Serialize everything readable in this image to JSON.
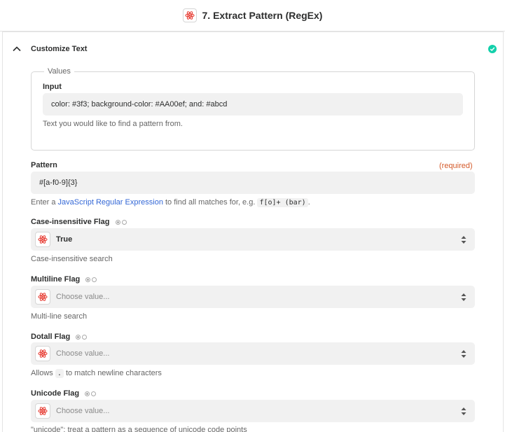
{
  "header": {
    "step_title": "7. Extract Pattern (RegEx)",
    "app_icon": "atom-icon"
  },
  "section": {
    "title": "Customize Text",
    "status": "complete",
    "status_color": "#13d0ab"
  },
  "values_group": {
    "legend": "Values",
    "input": {
      "label": "Input",
      "value": "color: #3f3; background-color: #AA00ef; and: #abcd",
      "help": "Text you would like to find a pattern from."
    }
  },
  "pattern": {
    "label": "Pattern",
    "required": "(required)",
    "value": "#[a-f0-9]{3}",
    "help_prefix": "Enter a",
    "help_link": "JavaScript Regular Expression",
    "help_mid": "to find all matches for, e.g.",
    "help_code": "f[o]+ (bar)",
    "help_suffix": "."
  },
  "case_flag": {
    "label": "Case-insensitive Flag",
    "value": "True",
    "help": "Case-insensitive search"
  },
  "multiline_flag": {
    "label": "Multiline Flag",
    "placeholder": "Choose value...",
    "help": "Multi-line search"
  },
  "dotall_flag": {
    "label": "Dotall Flag",
    "placeholder": "Choose value...",
    "help_prefix": "Allows",
    "help_code": ".",
    "help_suffix": "to match newline characters"
  },
  "unicode_flag": {
    "label": "Unicode Flag",
    "placeholder": "Choose value...",
    "help": "\"unicode\"; treat a pattern as a sequence of unicode code points"
  }
}
